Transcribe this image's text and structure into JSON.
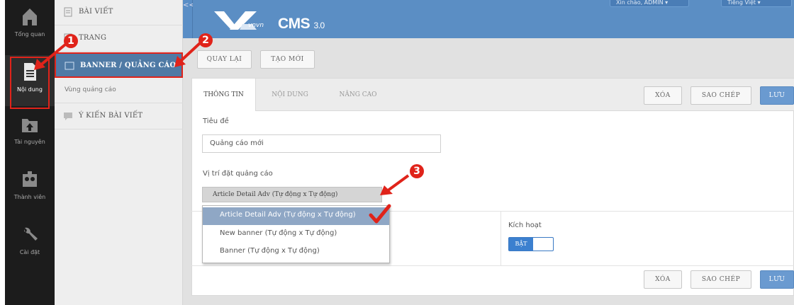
{
  "rail": {
    "items": [
      {
        "label": "Tổng quan",
        "icon": "home-icon"
      },
      {
        "label": "Nội dung",
        "icon": "document-icon"
      },
      {
        "label": "Tài nguyên",
        "icon": "upload-folder-icon"
      },
      {
        "label": "Thành viên",
        "icon": "users-icon"
      },
      {
        "label": "Cài đặt",
        "icon": "wrench-icon"
      }
    ]
  },
  "sidebar": {
    "items": [
      {
        "label": "Bài viết"
      },
      {
        "label": "Trang"
      },
      {
        "label": "Banner / Quảng cáo"
      },
      {
        "label": "Ý kiến bài viết"
      }
    ],
    "sub_item": "Vùng quảng cáo"
  },
  "header": {
    "collapse": "<<",
    "brand": "CMS",
    "version": "3.0",
    "brand_small": "vnvn",
    "greeting": "Xin chào, ADMIN ▾",
    "language": "Tiếng Việt ▾"
  },
  "toolbar": {
    "back_label": "QUAY LẠI",
    "new_label": "TẠO MỚI"
  },
  "tabs": [
    "THÔNG TIN",
    "NỘI DUNG",
    "NÂNG CAO"
  ],
  "actions": {
    "delete": "XÓA",
    "copy": "SAO CHÉP",
    "save": "LƯU"
  },
  "form": {
    "title_label": "Tiêu đề",
    "title_value": "Quảng cáo mới",
    "position_label": "Vị trí đặt quảng cáo",
    "position_value": "Article Detail Adv (Tự động x Tự động)",
    "options": [
      "Article Detail Adv (Tự động x Tự động)",
      "New banner (Tự động x Tự động)",
      "Banner (Tự động x Tự động)"
    ],
    "active_label": "Kích hoạt",
    "active_toggle": "BẬT"
  },
  "annotations": {
    "step1": "1",
    "step2": "2",
    "step3": "3"
  },
  "colors": {
    "header": "#5b8ec4",
    "accent_red": "#e0231a",
    "rail": "#1c1c1c"
  }
}
